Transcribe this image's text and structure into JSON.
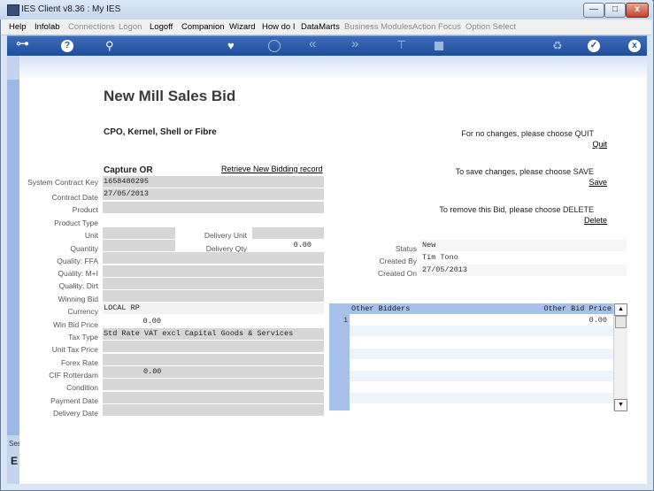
{
  "window": {
    "title": "IES Client v8.36 : My IES",
    "minimize": "—",
    "maximize": "□",
    "close": "x"
  },
  "menu": [
    {
      "label": "Help",
      "enabled": true
    },
    {
      "label": "Infolab",
      "enabled": true
    },
    {
      "label": "Connections",
      "enabled": false
    },
    {
      "label": "Logon",
      "enabled": false
    },
    {
      "label": "Logoff",
      "enabled": true
    },
    {
      "label": "Companion",
      "enabled": true
    },
    {
      "label": "Wizard",
      "enabled": true
    },
    {
      "label": "How do I",
      "enabled": true
    },
    {
      "label": "DataMarts",
      "enabled": true
    },
    {
      "label": "Business Modules",
      "enabled": false
    },
    {
      "label": "Action Focus",
      "enabled": false
    },
    {
      "label": "Option Select",
      "enabled": false
    }
  ],
  "toolbar": {
    "key": "⊶",
    "help": "?",
    "search": "⚲",
    "heart": "♥",
    "rewind": "«",
    "forward": "»",
    "tee": "⊤",
    "recycle": "♻",
    "check": "✓",
    "close": "x"
  },
  "sidebar": {
    "label": "Ses",
    "label2": "E"
  },
  "page": {
    "title": "New Mill Sales Bid",
    "subtitle": "CPO, Kernel, Shell or Fibre",
    "section": "Capture OR",
    "retrieve_link": "Retrieve New Bidding record"
  },
  "form": {
    "system_contract_key": {
      "label": "System Contract Key",
      "value": "1658480295"
    },
    "contract_date": {
      "label": "Contract Date",
      "value": "27/05/2013"
    },
    "product": {
      "label": "Product",
      "value": ""
    },
    "product_type": {
      "label": "Product Type",
      "value": ""
    },
    "unit": {
      "label": "Unit",
      "value": ""
    },
    "delivery_unit": {
      "label": "Delivery Unit",
      "value": ""
    },
    "quantity": {
      "label": "Quantity",
      "value": ""
    },
    "delivery_qty": {
      "label": "Delivery Qty",
      "value": "0.00"
    },
    "quality_ffa": {
      "label": "Quality: FFA",
      "value": ""
    },
    "quality_mi": {
      "label": "Quality: M+I",
      "value": ""
    },
    "quality_dirt": {
      "label": "Quality: Dirt",
      "value": ""
    },
    "winning_bid": {
      "label": "Winning Bid",
      "value": ""
    },
    "currency": {
      "label": "Currency",
      "value": "LOCAL RP"
    },
    "win_bid_price": {
      "label": "Win Bid Price",
      "value": "0.00"
    },
    "tax_type": {
      "label": "Tax Type",
      "value": "Std Rate VAT excl Capital Goods & Services"
    },
    "unit_tax_price": {
      "label": "Unit Tax Price",
      "value": ""
    },
    "forex_rate": {
      "label": "Forex Rate",
      "value": ""
    },
    "cif_rotterdam": {
      "label": "CIF Rotterdam",
      "value": "0.00"
    },
    "condition": {
      "label": "Condition",
      "value": ""
    },
    "payment_date": {
      "label": "Payment Date",
      "value": ""
    },
    "delivery_date": {
      "label": "Delivery Date",
      "value": ""
    }
  },
  "actions": {
    "quit_text": "For no changes, please choose QUIT",
    "quit_link": "Quit",
    "save_text": "To save changes, please choose SAVE",
    "save_link": "Save",
    "delete_text": "To remove this Bid,  please choose  DELETE",
    "delete_link": "Delete"
  },
  "status": {
    "status_label": "Status",
    "status_value": "New",
    "created_by_label": "Created By",
    "created_by_value": "Tim Tono",
    "created_on_label": "Created On",
    "created_on_value": "27/05/2013"
  },
  "grid": {
    "col_bidders": "Other Bidders",
    "col_price": "Other Bid Price",
    "rows": [
      {
        "num": "1",
        "bidder": "",
        "price": "0.00"
      }
    ],
    "scroll_up": "▲",
    "scroll_down": "▼"
  }
}
